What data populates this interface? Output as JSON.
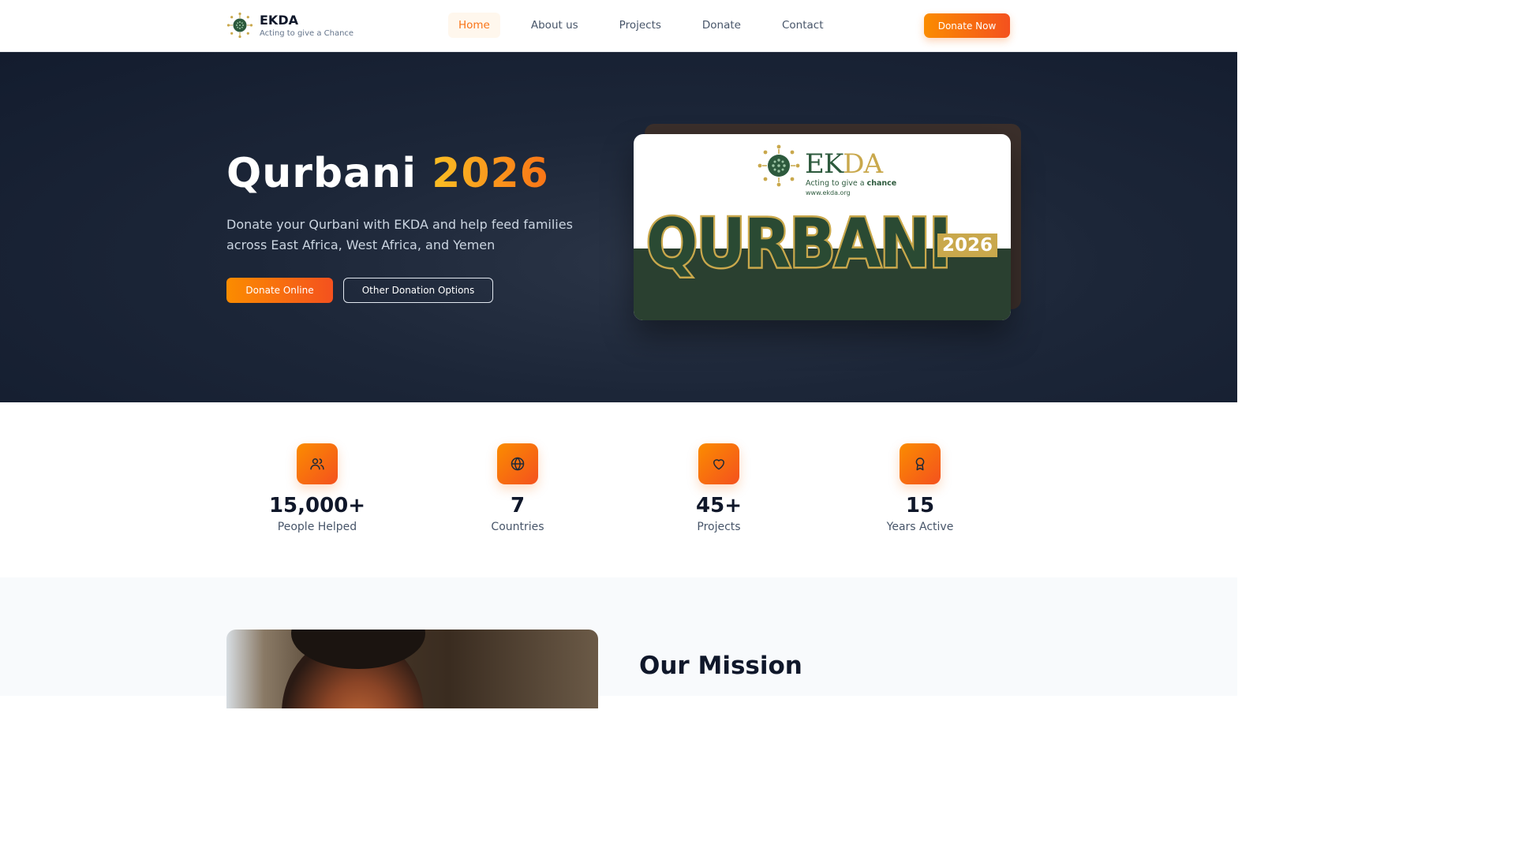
{
  "brand": {
    "name": "EKDA",
    "tagline": "Acting to give a Chance"
  },
  "nav": {
    "links": [
      {
        "label": "Home",
        "active": true
      },
      {
        "label": "About us"
      },
      {
        "label": "Projects"
      },
      {
        "label": "Donate"
      },
      {
        "label": "Contact"
      }
    ],
    "cta_label": "Donate Now"
  },
  "hero": {
    "title": "Qurbani",
    "year": "2026",
    "subtitle": "Donate your Qurbani with EKDA and help feed families across East Africa, West Africa, and Yemen",
    "primary_button": "Donate Online",
    "secondary_button": "Other Donation Options",
    "poster": {
      "logo_text_green": "EK",
      "logo_text_gold": "DA",
      "tagline_prefix": "Acting to give a",
      "tagline_bold": "chance",
      "url": "www.ekda.org",
      "headline": "QURBANI",
      "year": "2026"
    }
  },
  "stats": [
    {
      "icon": "users-icon",
      "value": "15,000+",
      "label": "People Helped"
    },
    {
      "icon": "globe-icon",
      "value": "7",
      "label": "Countries"
    },
    {
      "icon": "heart-icon",
      "value": "45+",
      "label": "Projects"
    },
    {
      "icon": "award-icon",
      "value": "15",
      "label": "Years Active"
    }
  ],
  "mission": {
    "title": "Our Mission"
  },
  "colors": {
    "accent": "#f97316",
    "hero_bg": "#1c2638",
    "brand_green": "#2d5a3d",
    "brand_gold": "#c9a84c"
  }
}
